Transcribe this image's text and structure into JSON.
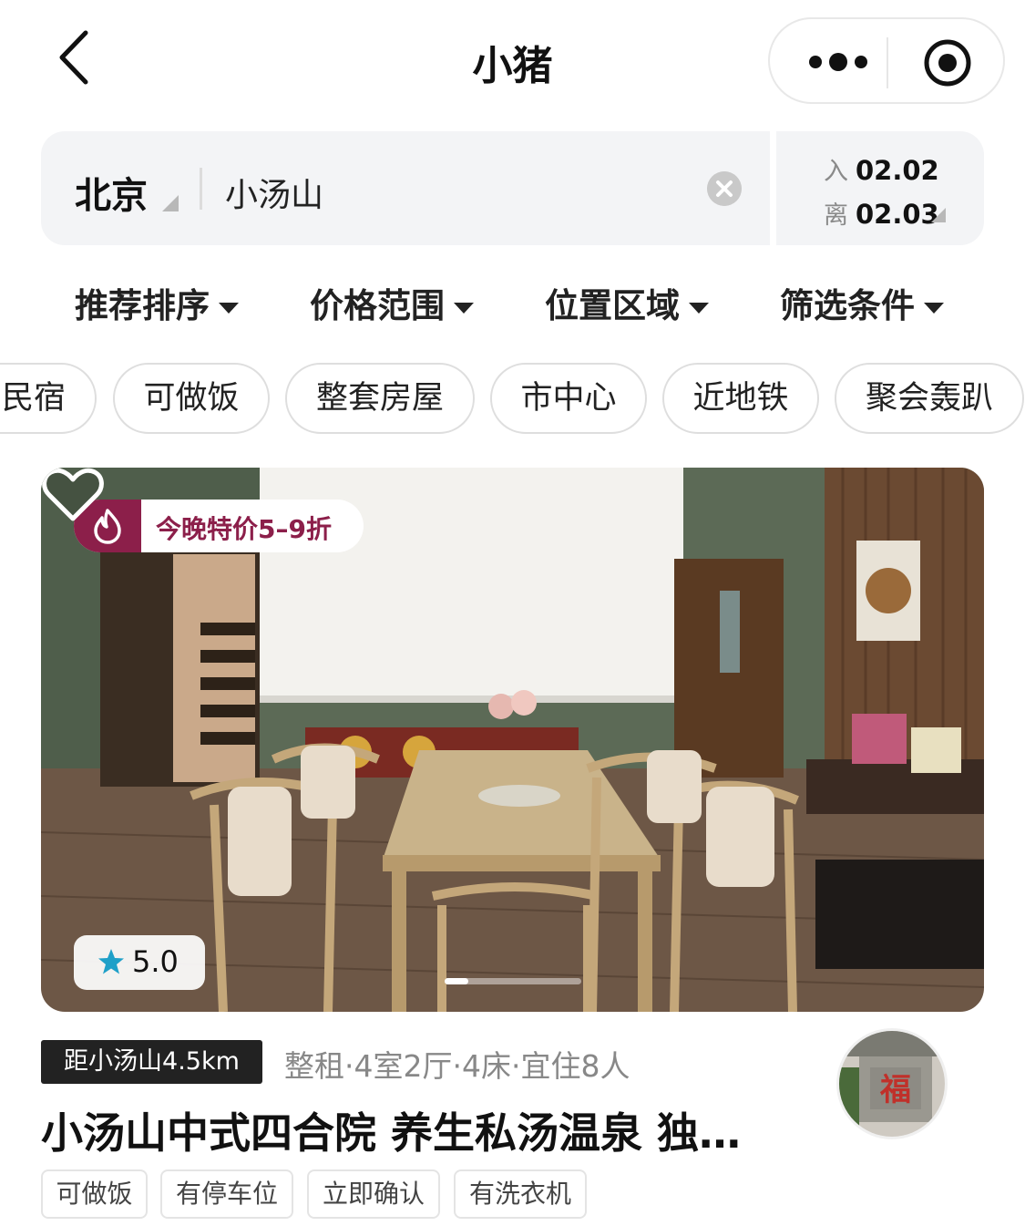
{
  "nav": {
    "title": "小猪",
    "back_icon": "chevron-left-icon",
    "more_icon": "more-dots-icon",
    "close_icon": "target-circle-icon"
  },
  "search": {
    "city": "北京",
    "keyword": "小汤山",
    "clear_icon": "clear-circle-icon",
    "checkin_label": "入",
    "checkin_date": "02.02",
    "checkout_label": "离",
    "checkout_date": "02.03"
  },
  "filters": [
    "推荐排序",
    "价格范围",
    "位置区域",
    "筛选条件"
  ],
  "chips": [
    "民宿",
    "可做饭",
    "整套房屋",
    "市中心",
    "近地铁",
    "聚会轰趴"
  ],
  "listing": {
    "deal_text": "今晚特价5–9折",
    "deal_icon": "flame-icon",
    "rating": "5.0",
    "photo_count_active": 1,
    "distance": "距小汤山4.5km",
    "meta": "整租·4室2厅·4床·宜住8人",
    "title": "小汤山中式四合院 养生私汤温泉 独…",
    "tags": [
      "可做饭",
      "有停车位",
      "立即确认",
      "有洗衣机"
    ],
    "colors": {
      "accent": "#8c1f4a",
      "star": "#1fa0c8"
    }
  }
}
